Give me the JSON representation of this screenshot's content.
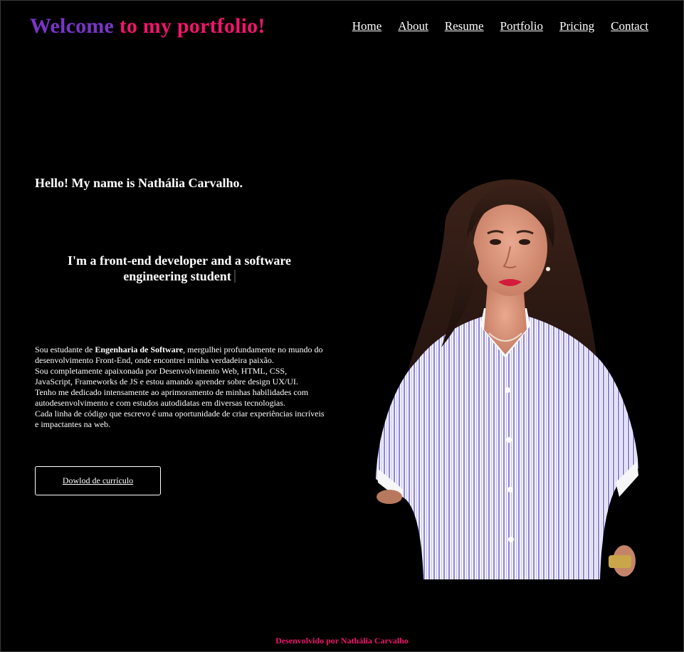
{
  "colors": {
    "background": "#000000",
    "logo_purple": "#7a35c8",
    "logo_pink": "#f0156c",
    "footer_pink": "#f0156c",
    "text": "#ffffff"
  },
  "header": {
    "logo_part1": "Welcome ",
    "logo_part2": "to my portfolio!",
    "nav": [
      {
        "label": "Home"
      },
      {
        "label": "About"
      },
      {
        "label": "Resume"
      },
      {
        "label": "Portfolio"
      },
      {
        "label": "Pricing"
      },
      {
        "label": "Contact"
      }
    ]
  },
  "hero": {
    "greeting": "Hello! My name is Nathália Carvalho.",
    "tagline": "I'm a front-end developer and a software engineering student",
    "bio": {
      "line1_pre": "Sou estudante de ",
      "line1_bold": "Engenharia de Software",
      "line1_post": ", mergulhei profundamente no mundo do desenvolvimento Front-End, onde encontrei minha verdadeira paixão.",
      "line2": "Sou completamente apaixonada por Desenvolvimento Web, HTML, CSS, JavaScript, Frameworks de JS e estou amando aprender sobre design UX/UI.",
      "line3": "Tenho me dedicado intensamente ao aprimoramento de minhas habilidades com autodesenvolvimento e com estudos autodidatas em diversas tecnologias.",
      "line4": "Cada linha de código que escrevo é uma oportunidade de criar experiências incríveis e impactantes na web."
    },
    "cv_button": "Dowlod de currículo"
  },
  "footer": {
    "credit": "Desenvolvido por Nathália Carvalho"
  }
}
